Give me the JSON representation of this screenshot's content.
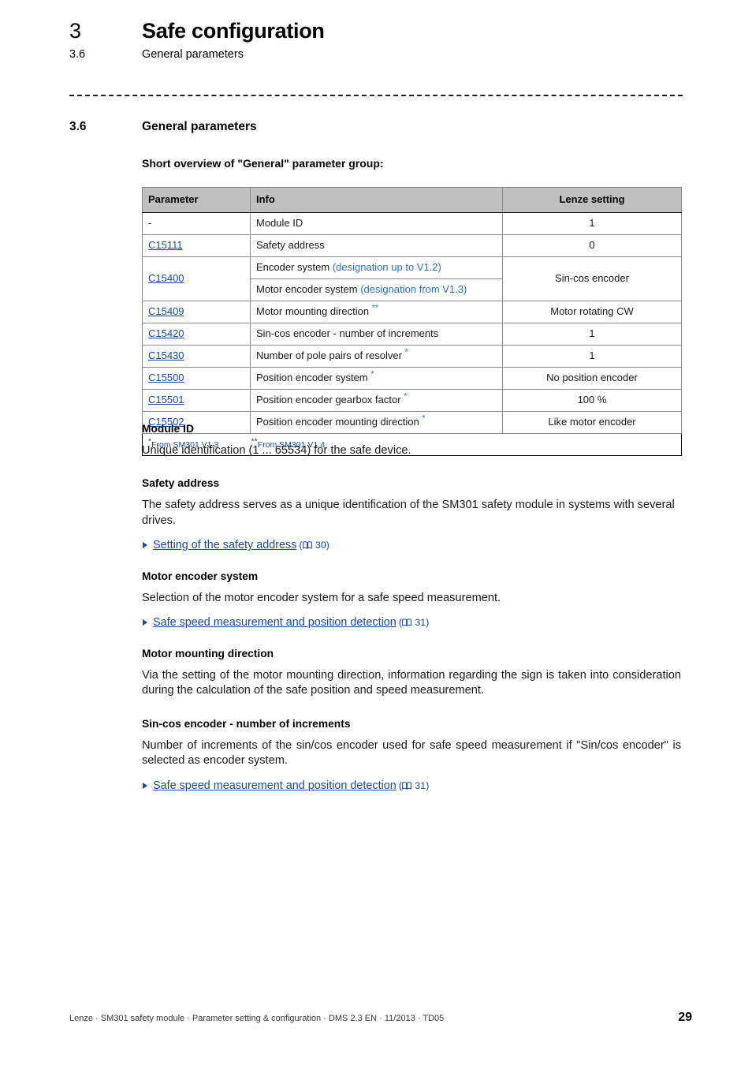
{
  "running_header": {
    "chapter_number": "3",
    "chapter_title": "Safe configuration",
    "section_number": "3.6",
    "section_title": "General parameters"
  },
  "section": {
    "number": "3.6",
    "title": "General parameters",
    "overview_line": "Short overview of \"General\" parameter group:"
  },
  "table": {
    "columns": [
      "Parameter",
      "Info",
      "Lenze setting"
    ],
    "rows": [
      {
        "parameter": "-",
        "info": "Module ID",
        "lenze": "1"
      },
      {
        "parameter": "C15111",
        "parameter_is_link": true,
        "info": "Safety address",
        "lenze": "0"
      },
      {
        "parameter": "C15400",
        "parameter_is_link": true,
        "info": "Encoder system ",
        "info_note": "(designation up to V1.2)",
        "lenze": "Sin-cos encoder"
      },
      {
        "parameter": "",
        "info": "Motor encoder system ",
        "info_note": "(designation from V1.3)",
        "lenze": ""
      },
      {
        "parameter": "C15409",
        "parameter_is_link": true,
        "info": "Motor mounting direction ",
        "footnote": "**",
        "lenze": "Motor rotating CW"
      },
      {
        "parameter": "C15420",
        "parameter_is_link": true,
        "info": "Sin-cos encoder - number of increments",
        "lenze": "1"
      },
      {
        "parameter": "C15430",
        "parameter_is_link": true,
        "info": "Number of pole pairs of resolver ",
        "footnote": "*",
        "lenze": "1"
      },
      {
        "parameter": "C15500",
        "parameter_is_link": true,
        "info": "Position encoder system ",
        "footnote": "*",
        "lenze": "No position encoder"
      },
      {
        "parameter": "C15501",
        "parameter_is_link": true,
        "info": "Position encoder gearbox factor ",
        "footnote": "*",
        "lenze": "100 %"
      },
      {
        "parameter": "C15502",
        "parameter_is_link": true,
        "info": "Position encoder mounting direction ",
        "footnote": "*",
        "lenze": "Like motor encoder"
      }
    ],
    "footnotes": {
      "single_star_mark": "*",
      "single_star_text": "From SM301 V1.3",
      "double_star_mark": "**",
      "double_star_text": "From SM301 V1.4"
    }
  },
  "sections": {
    "module_id": {
      "heading": "Module ID",
      "text": "Unique identification (1 ... 65534) for the safe device."
    },
    "safety_address": {
      "heading": "Safety address",
      "text": "The safety address serves as a unique identification of the SM301 safety module in systems with several drives.",
      "xref_label": "Setting of the safety address",
      "xref_page": "30"
    },
    "motor_encoder_system": {
      "heading": "Motor encoder system",
      "text": "Selection of the motor encoder system for a safe speed measurement.",
      "xref_label": "Safe speed measurement and position detection",
      "xref_page": "31"
    },
    "motor_mounting_direction": {
      "heading": "Motor mounting direction",
      "text": "Via the setting of the motor mounting direction, information regarding the sign is taken into consideration during the calculation of the safe position and speed measurement."
    },
    "sin_cos_increments": {
      "heading": "Sin-cos encoder - number of increments",
      "text": "Number of increments of the sin/cos encoder used for safe speed measurement if \"Sin/cos encoder\" is selected as encoder system.",
      "xref_label": "Safe speed measurement and position detection",
      "xref_page": "31"
    }
  },
  "footer": {
    "text": "Lenze · SM301 safety module · Parameter setting & configuration · DMS 2.3 EN · 11/2013 · TD05",
    "page_number": "29"
  },
  "colors": {
    "link_blue": "#1b4a9c",
    "note_blue": "#2f6fd0",
    "table_header_gray": "#bfbfbf"
  },
  "icons": {
    "xref_bullet": "triangle-right-icon",
    "xref_page": "open-book-icon"
  }
}
